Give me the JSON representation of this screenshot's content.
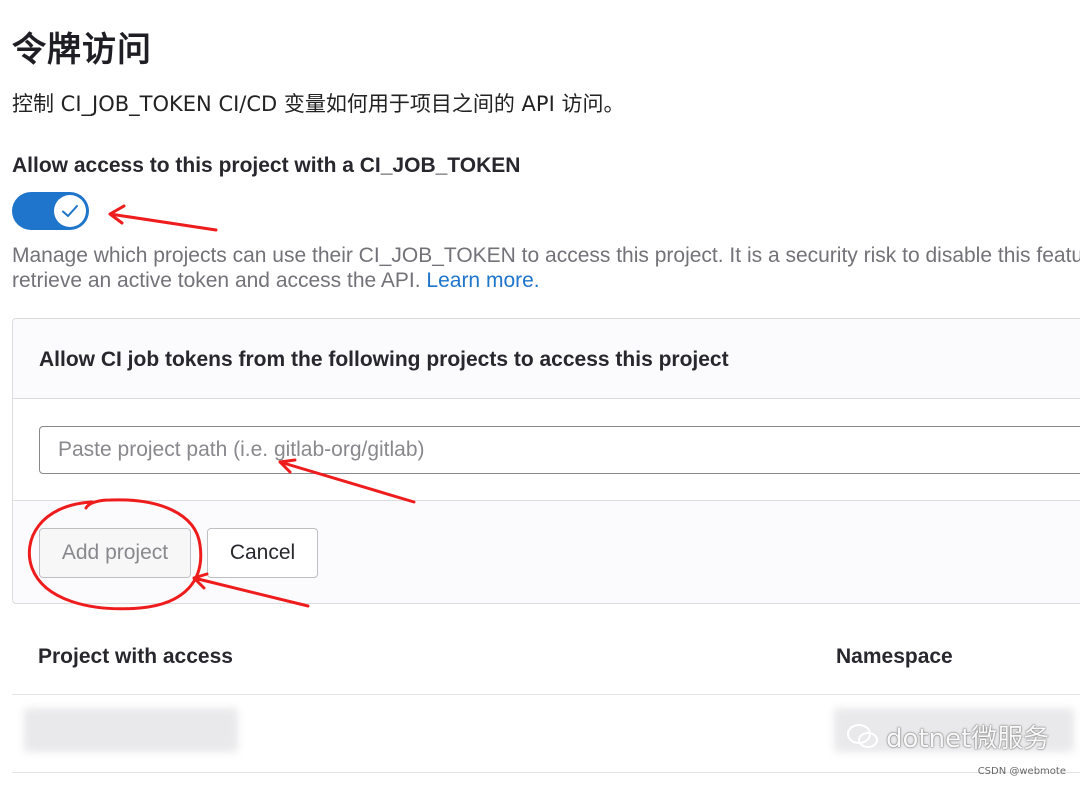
{
  "page": {
    "title": "令牌访问",
    "subtitle": "控制 CI_JOB_TOKEN CI/CD 变量如何用于项目之间的 API 访问。"
  },
  "access_toggle": {
    "label": "Allow access to this project with a CI_JOB_TOKEN",
    "enabled": true,
    "help_line1": "Manage which projects can use their CI_JOB_TOKEN to access this project. It is a security risk to disable this feature, because unauthorized projects might attempt to",
    "help_line2_prefix": "retrieve an active token and access the API. ",
    "learn_more": "Learn more."
  },
  "allowlist_card": {
    "header": "Allow CI job tokens from the following projects to access this project",
    "input_value": "",
    "input_placeholder": "Paste project path (i.e. gitlab-org/gitlab)",
    "add_button": "Add project",
    "cancel_button": "Cancel"
  },
  "table": {
    "columns": [
      "Project with access",
      "Namespace"
    ]
  },
  "watermark": {
    "text": "dotnet微服务",
    "credit": "CSDN @webmote"
  },
  "colors": {
    "accent": "#1f75cb",
    "annotation": "#ee1c1c"
  }
}
